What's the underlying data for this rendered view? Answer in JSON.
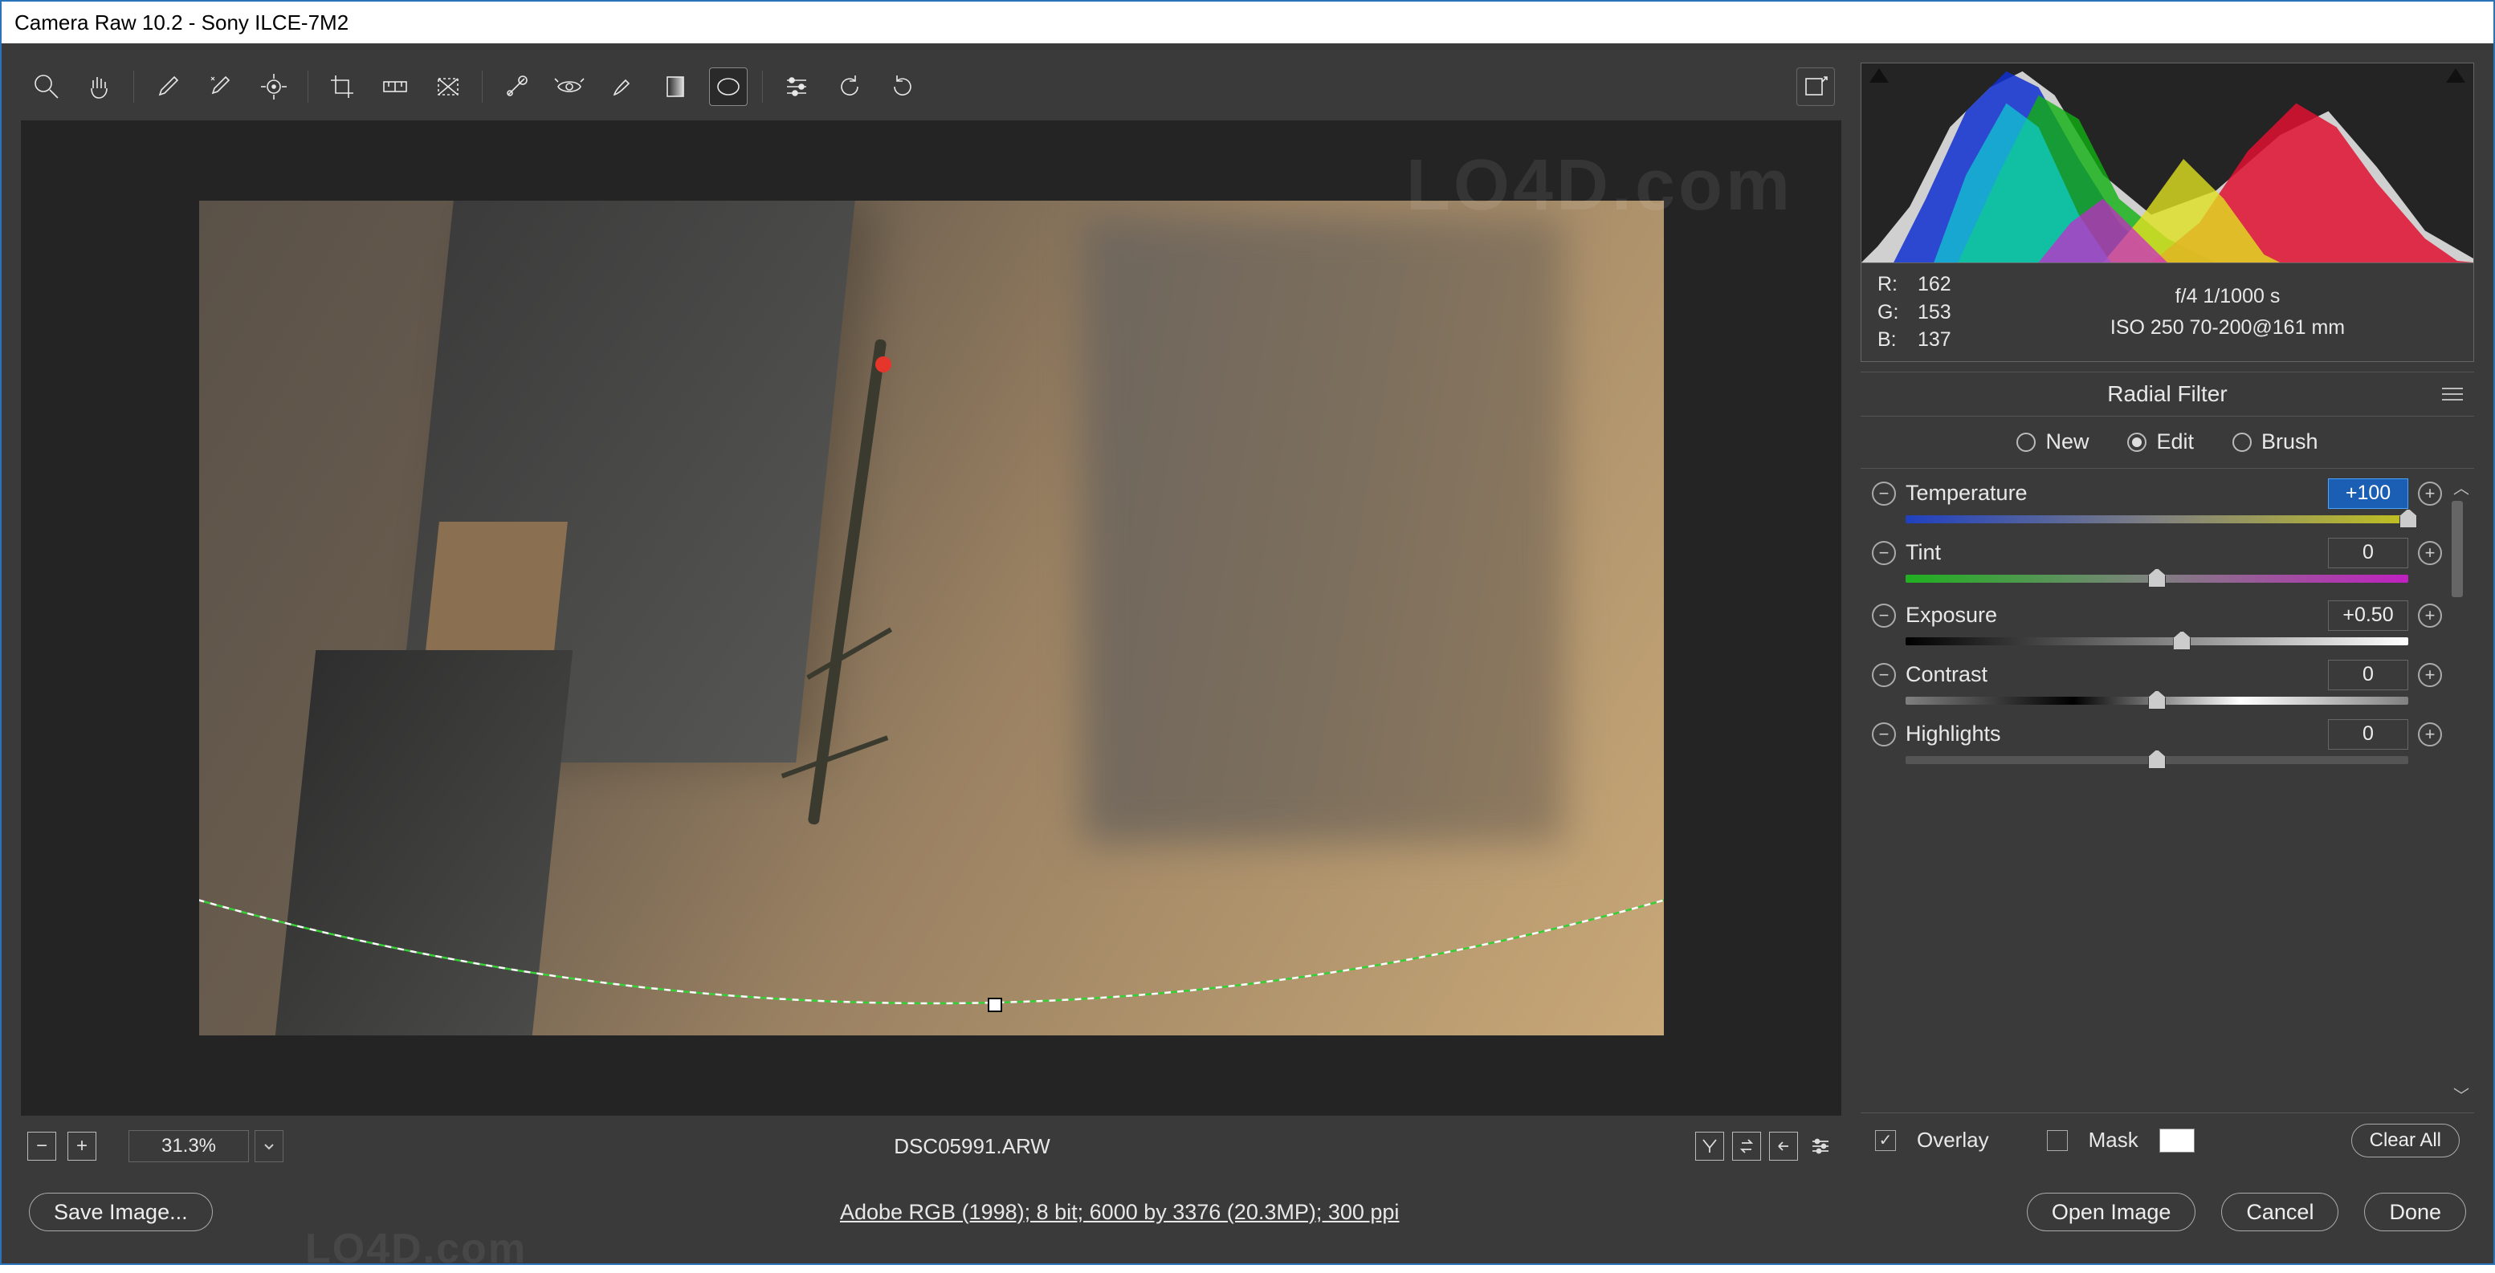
{
  "title": "Camera Raw 10.2  -  Sony ILCE-7M2",
  "toolbar_icons": [
    "zoom",
    "hand",
    "wb-eyedropper",
    "color-sampler",
    "target-adjust",
    "crop",
    "straighten",
    "transform",
    "spot-removal",
    "redeye",
    "brush",
    "graduated-filter",
    "radial-filter",
    "preferences",
    "rotate-ccw",
    "rotate-cw"
  ],
  "canvas": {
    "marker": true
  },
  "strip": {
    "zoom": "31.3%",
    "filename": "DSC05991.ARW"
  },
  "histogram": {
    "rgb": {
      "R": "162",
      "G": "153",
      "B": "137"
    },
    "meta1": "f/4   1/1000 s",
    "meta2": "ISO 250   70-200@161 mm"
  },
  "panel": {
    "title": "Radial Filter",
    "modes": {
      "new": "New",
      "edit": "Edit",
      "brush": "Brush",
      "selected": "edit"
    },
    "sliders": [
      {
        "key": "temperature",
        "label": "Temperature",
        "value": "+100",
        "pos": 100,
        "track": "temp",
        "hl": true
      },
      {
        "key": "tint",
        "label": "Tint",
        "value": "0",
        "pos": 50,
        "track": "tint"
      },
      {
        "key": "exposure",
        "label": "Exposure",
        "value": "+0.50",
        "pos": 55,
        "track": "exp",
        "gap": true
      },
      {
        "key": "contrast",
        "label": "Contrast",
        "value": "0",
        "pos": 50,
        "track": "con"
      },
      {
        "key": "highlights",
        "label": "Highlights",
        "value": "0",
        "pos": 50,
        "track": "plain"
      }
    ],
    "footer": {
      "overlay": "Overlay",
      "overlay_on": true,
      "mask": "Mask",
      "mask_on": false,
      "clear": "Clear All"
    }
  },
  "footer": {
    "save": "Save Image...",
    "meta": "Adobe RGB (1998); 8 bit; 6000 by 3376 (20.3MP); 300 ppi",
    "open": "Open Image",
    "cancel": "Cancel",
    "done": "Done"
  },
  "watermark": "LO4D.com"
}
